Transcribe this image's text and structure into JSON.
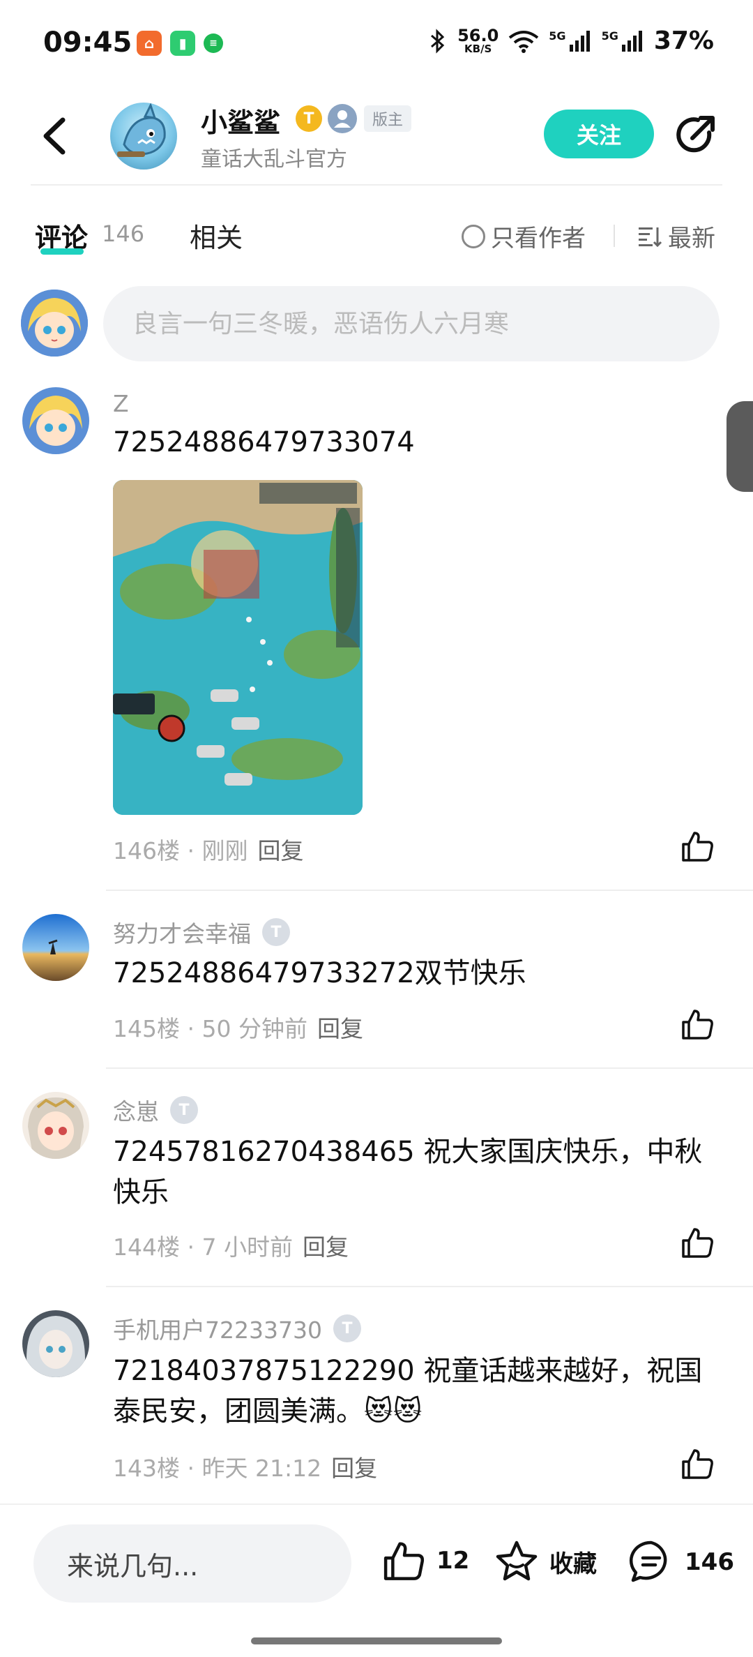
{
  "status_bar": {
    "time": "09:45",
    "net_speed": "56.0",
    "net_unit": "KB/S",
    "signal1": "5G",
    "signal2": "5G",
    "battery": "37%"
  },
  "header": {
    "name": "小鲨鲨",
    "level_badge": "T",
    "host_tag": "版主",
    "subtitle": "童话大乱斗官方",
    "follow_label": "关注"
  },
  "tabs": {
    "comment_label": "评论",
    "comment_count": "146",
    "related_label": "相关",
    "only_author_label": "只看作者",
    "sort_label": "最新"
  },
  "composer": {
    "placeholder": "良言一句三冬暖，恶语伤人六月寒"
  },
  "comments": [
    {
      "user": "Z",
      "text": "72524886479733074",
      "floor": "146楼",
      "time": "刚刚",
      "reply": "回复"
    },
    {
      "user": "努力才会幸福",
      "level": "T",
      "text": "72524886479733272双节快乐",
      "floor": "145楼",
      "time": "50 分钟前",
      "reply": "回复"
    },
    {
      "user": "念崽",
      "level": "T",
      "text": "72457816270438465  祝大家国庆快乐，中秋快乐",
      "floor": "144楼",
      "time": "7 小时前",
      "reply": "回复"
    },
    {
      "user": "手机用户72233730",
      "level": "T",
      "text": "72184037875122290  祝童话越来越好，祝国泰民安，团圆美满。😻😻",
      "floor": "143楼",
      "time": "昨天 21:12",
      "reply": "回复"
    }
  ],
  "bottom_bar": {
    "input_placeholder": "来说几句...",
    "like_count": "12",
    "favorite_label": "收藏",
    "comment_count": "146"
  },
  "colors": {
    "accent": "#1fd1bf",
    "level_gold": "#f4b81f"
  }
}
